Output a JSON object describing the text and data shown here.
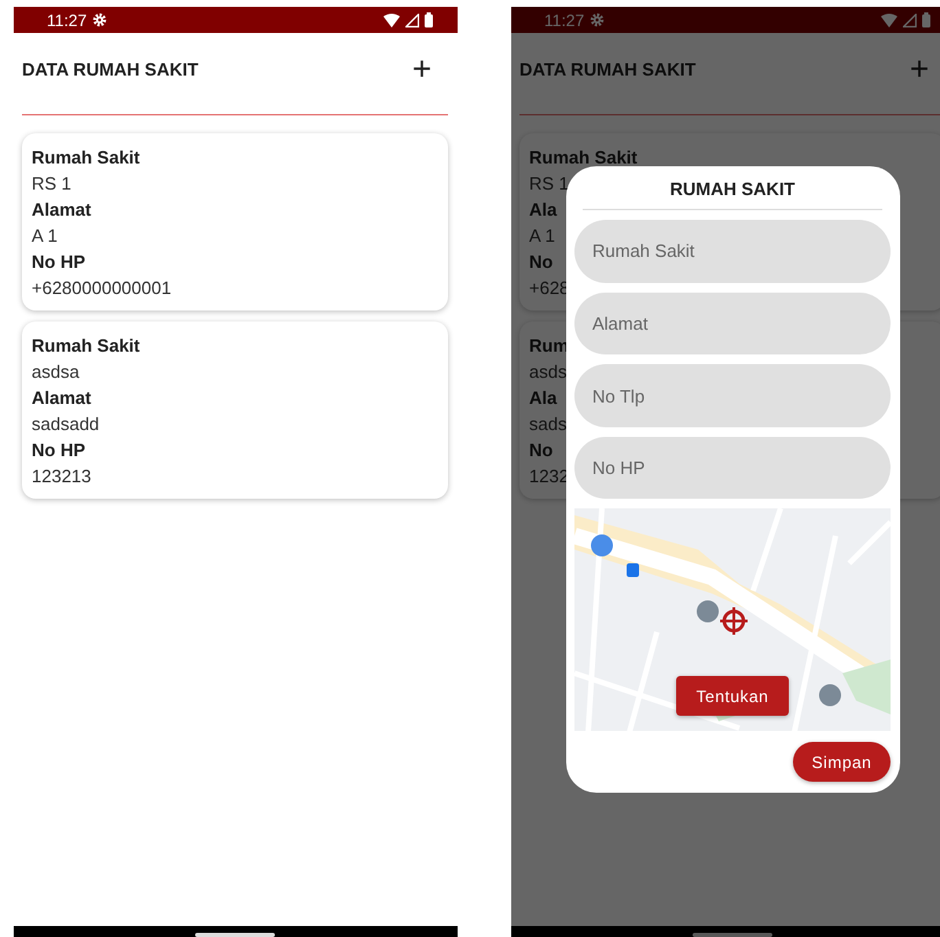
{
  "screens": [
    {
      "status_bar": {
        "time": "11:27"
      },
      "title": "DATA RUMAH SAKIT",
      "add_button": "+",
      "cards": [
        {
          "fields": [
            {
              "label": "Rumah Sakit",
              "value": "RS 1"
            },
            {
              "label": "Alamat",
              "value": "A 1"
            },
            {
              "label": "No HP",
              "value": "+6280000000001"
            }
          ]
        },
        {
          "fields": [
            {
              "label": "Rumah Sakit",
              "value": "asdsa"
            },
            {
              "label": "Alamat",
              "value": "sadsadd"
            },
            {
              "label": "No HP",
              "value": "123213"
            }
          ]
        }
      ]
    },
    {
      "status_bar": {
        "time": "11:27"
      },
      "title": "DATA RUMAH SAKIT",
      "add_button": "+",
      "cards": [
        {
          "fields": [
            {
              "label": "Rumah Sakit",
              "value": "RS 1"
            },
            {
              "label": "Ala",
              "value": "A 1"
            },
            {
              "label": "No",
              "value": "+628"
            }
          ]
        },
        {
          "fields": [
            {
              "label": "Rum",
              "value": "asds"
            },
            {
              "label": "Ala",
              "value": "sads"
            },
            {
              "label": "No",
              "value": "1232"
            }
          ]
        }
      ],
      "dialog": {
        "title": "RUMAH SAKIT",
        "fields": [
          {
            "placeholder": "Rumah Sakit"
          },
          {
            "placeholder": "Alamat"
          },
          {
            "placeholder": "No Tlp"
          },
          {
            "placeholder": "No HP"
          }
        ],
        "map_button": "Tentukan",
        "save_button": "Simpan"
      }
    }
  ]
}
